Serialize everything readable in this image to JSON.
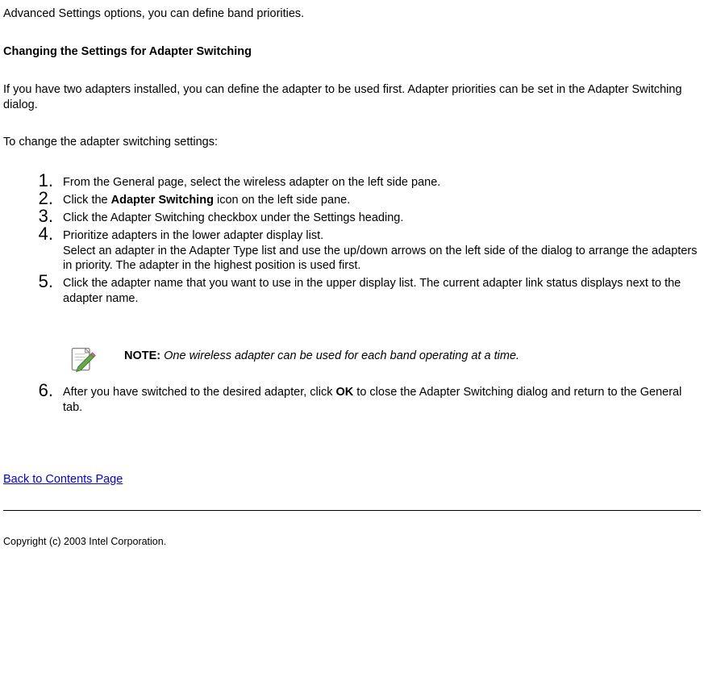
{
  "intro_fragment": "Advanced Settings options, you can define band priorities.",
  "heading": "Changing the Settings for Adapter Switching",
  "para1": "If you have two adapters installed, you can define the adapter to be used first. Adapter priorities can be set in the Adapter Switching dialog.",
  "para2": "To change the adapter switching settings:",
  "steps": {
    "s1": "From the General page, select the wireless adapter on the left side pane.",
    "s2_pre": "Click the ",
    "s2_bold": "Adapter Switching",
    "s2_post": " icon on the left side pane.",
    "s3": "Click the Adapter Switching checkbox under the Settings heading.",
    "s4a": "Prioritize adapters in the lower adapter display list.",
    "s4b": "Select an adapter in the Adapter Type list and use the up/down arrows on the left side of the dialog to arrange the adapters in priority. The adapter in the highest position is used first.",
    "s5": "Click the adapter name that you want to use in the upper display list. The current adapter link status displays next to the adapter name.",
    "s6_pre": "After you have switched to the desired adapter, click ",
    "s6_bold": "OK",
    "s6_post": " to close the Adapter Switching dialog and return to the General tab."
  },
  "note": {
    "label": "NOTE:",
    "body": "One wireless adapter can be used for each band operating at a time."
  },
  "back_link": "Back to Contents Page",
  "copyright": "Copyright (c) 2003 Intel Corporation.",
  "nums": {
    "n1": "1.",
    "n2": "2.",
    "n3": "3.",
    "n4": "4.",
    "n5": "5.",
    "n6": "6."
  }
}
